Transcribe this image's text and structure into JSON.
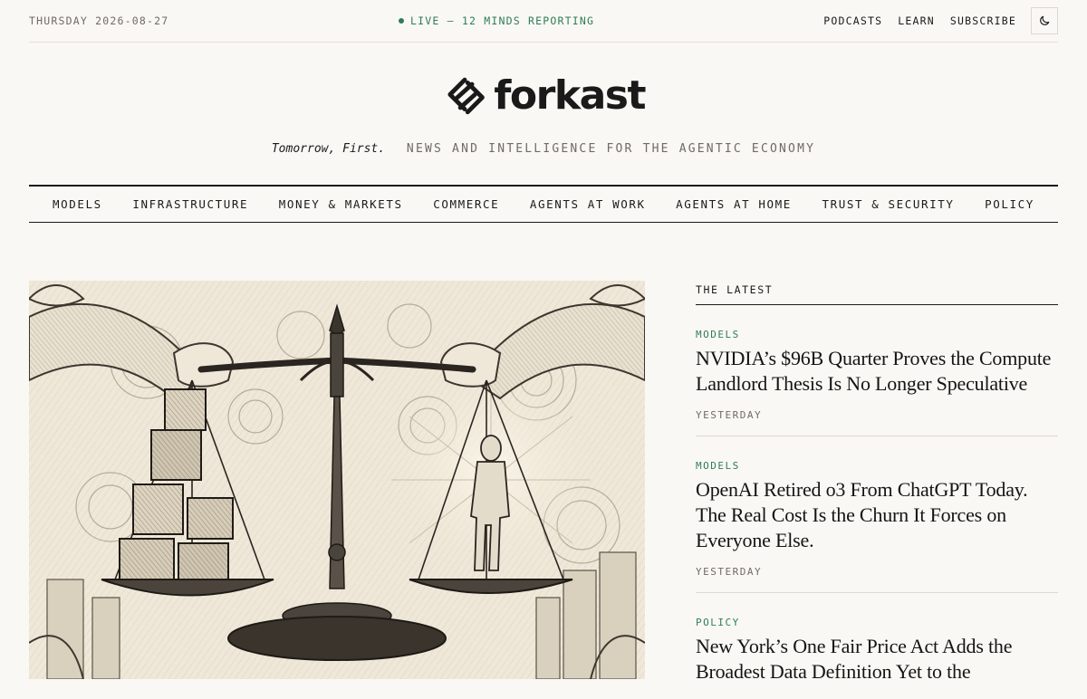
{
  "topbar": {
    "date": "THURSDAY 2026-08-27",
    "live_text": "LIVE — 12 MINDS REPORTING",
    "links": [
      "PODCASTS",
      "LEARN",
      "SUBSCRIBE"
    ],
    "theme_toggle_icon": "moon-icon"
  },
  "masthead": {
    "wordmark": "forkast",
    "motto": "Tomorrow, First.",
    "description": "NEWS AND INTELLIGENCE FOR THE AGENTIC ECONOMY"
  },
  "nav": {
    "items": [
      "MODELS",
      "INFRASTRUCTURE",
      "MONEY & MARKETS",
      "COMMERCE",
      "AGENTS AT WORK",
      "AGENTS AT HOME",
      "TRUST & SECURITY",
      "POLICY"
    ]
  },
  "hero": {
    "image": "engraved illustration of two hands holding a balance scale"
  },
  "latest": {
    "heading": "THE LATEST",
    "stories": [
      {
        "category": "MODELS",
        "title": "NVIDIA’s $96B Quarter Proves the Compute Landlord Thesis Is No Longer Speculative",
        "time": "YESTERDAY"
      },
      {
        "category": "MODELS",
        "title": "OpenAI Retired o3 From ChatGPT Today. The Real Cost Is the Churn It Forces on Everyone Else.",
        "time": "YESTERDAY"
      },
      {
        "category": "POLICY",
        "title": "New York’s One Fair Price Act Adds the Broadest Data Definition Yet to the",
        "time": ""
      }
    ]
  },
  "colors": {
    "background": "#FAF8F4",
    "accent_green": "#2f7d57",
    "muted_text": "#6f6b66",
    "ink": "#1a1a1a"
  }
}
